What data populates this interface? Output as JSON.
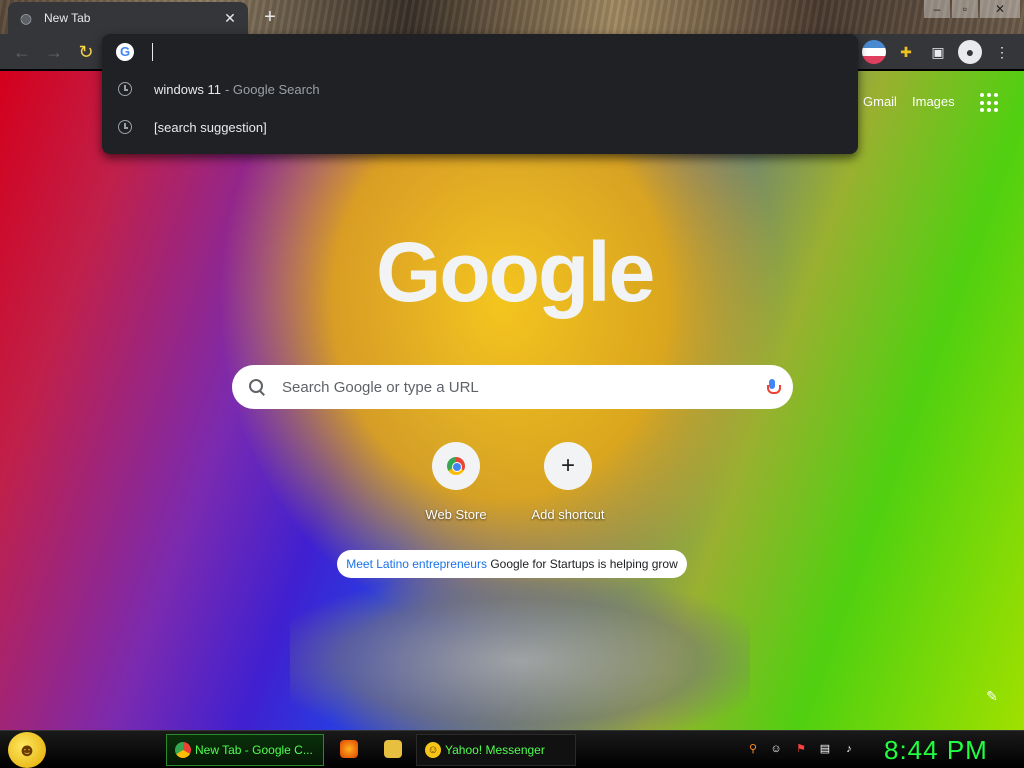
{
  "browser": {
    "tab_title": "New Tab",
    "tab_close_icon": "close-icon",
    "new_tab_icon": "plus-icon"
  },
  "omnibox": {
    "value": "",
    "suggestions": [
      {
        "text": "windows 11",
        "suffix": "- Google Search",
        "icon": "history-clock-icon"
      },
      {
        "text": "[search suggestion]",
        "suffix": "",
        "icon": "history-clock-icon"
      }
    ]
  },
  "ntp": {
    "header_links": {
      "gmail": "Gmail",
      "images": "Images"
    },
    "logo_text": "Google",
    "search_placeholder": "Search Google or type a URL",
    "shortcuts": [
      {
        "label": "Web Store",
        "icon": "web-store-icon"
      },
      {
        "label": "Add shortcut",
        "icon": "plus-icon"
      }
    ],
    "promo": {
      "link_text": "Meet Latino entrepreneurs",
      "rest_text": "Google for Startups is helping grow"
    }
  },
  "taskbar": {
    "tasks": [
      {
        "label": "New Tab - Google C...",
        "icon": "chrome-icon"
      },
      {
        "label": "Yahoo! Messenger",
        "icon": "yahoo-messenger-icon"
      }
    ],
    "clock": "8:44 PM"
  },
  "colors": {
    "accent_green": "#20ff40",
    "toolbar_dark": "#35363a",
    "omnibox_bg": "#202124",
    "promo_link": "#1a73e8"
  }
}
